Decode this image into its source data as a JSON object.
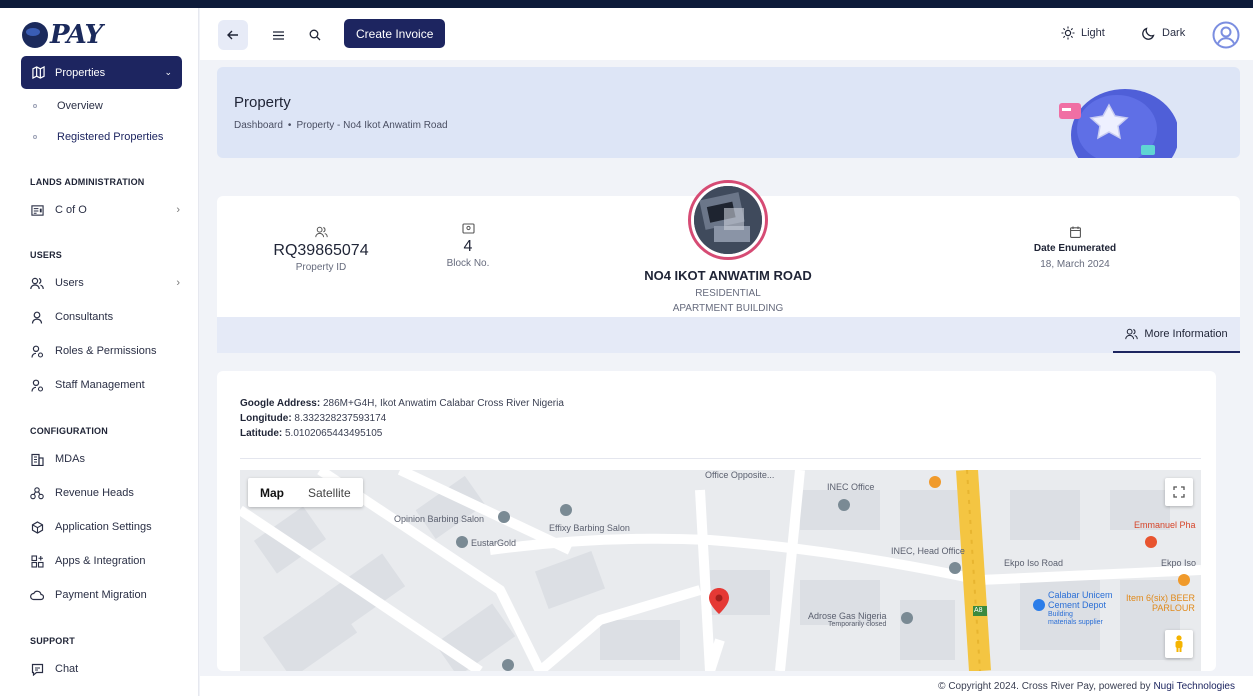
{
  "logo": {
    "text": "PAY"
  },
  "sidebar": {
    "active": {
      "label": "Properties"
    },
    "sub_items": [
      {
        "label": "Overview"
      },
      {
        "label": "Registered Properties"
      }
    ],
    "sections": [
      {
        "title": "LANDS ADMINISTRATION",
        "items": [
          {
            "label": "C of O",
            "icon": "certificate-icon"
          }
        ]
      },
      {
        "title": "USERS",
        "items": [
          {
            "label": "Users",
            "icon": "users-icon"
          },
          {
            "label": "Consultants",
            "icon": "user-icon"
          },
          {
            "label": "Roles & Permissions",
            "icon": "user-key-icon"
          },
          {
            "label": "Staff Management",
            "icon": "user-key-icon"
          }
        ]
      },
      {
        "title": "CONFIGURATION",
        "items": [
          {
            "label": "MDAs",
            "icon": "building-icon"
          },
          {
            "label": "Revenue Heads",
            "icon": "org-chart-icon"
          },
          {
            "label": "Application Settings",
            "icon": "cube-icon"
          },
          {
            "label": "Apps & Integration",
            "icon": "grid-icon"
          },
          {
            "label": "Payment Migration",
            "icon": "cloud-icon"
          }
        ]
      },
      {
        "title": "SUPPORT",
        "items": [
          {
            "label": "Chat",
            "icon": "chat-icon"
          }
        ]
      }
    ]
  },
  "header": {
    "create_label": "Create Invoice",
    "light_label": "Light",
    "dark_label": "Dark"
  },
  "page": {
    "title": "Property",
    "breadcrumb": [
      "Dashboard",
      "Property - No4 Ikot Anwatim Road"
    ]
  },
  "property": {
    "id_value": "RQ39865074",
    "id_label": "Property ID",
    "block_value": "4",
    "block_label": "Block No.",
    "name": "NO4 IKOT ANWATIM ROAD",
    "type": "RESIDENTIAL",
    "subtype": "APARTMENT BUILDING",
    "date_label": "Date Enumerated",
    "date_value": "18, March 2024",
    "more_info": "More Information"
  },
  "address": {
    "google_label": "Google Address:",
    "google_value": " 286M+G4H, Ikot Anwatim Calabar Cross River Nigeria",
    "lng_label": "Longitude:",
    "lng_value": " 8.332328237593174",
    "lat_label": "Latitude:",
    "lat_value": " 5.0102065443495105"
  },
  "map": {
    "map_tab": "Map",
    "satellite_tab": "Satellite",
    "labels": {
      "office_opposite": "Office Opposite...",
      "inec_office": "INEC Office",
      "opinion": "Opinion Barbing Salon",
      "effixy": "Effixy Barbing Salon",
      "eustar": "EustarGold",
      "inec_head": "INEC, Head Office",
      "ekpo1": "Ekpo Iso Road",
      "ekpo2": "Ekpo Iso",
      "emmanuel": "Emmanuel Pha",
      "adrose": "Adrose Gas Nigeria",
      "adrose_sub": "Temporarily closed",
      "calabar": "Calabar Unicem",
      "cement": "Cement Depot",
      "building": "Building",
      "materials": "materials supplier",
      "item6": "Item 6(six) BEER",
      "parlour": "PARLOUR",
      "route": "A8"
    }
  },
  "footer": {
    "copyright": "© Copyright 2024. Cross River Pay, powered by",
    "brand": "Nugi Technologies"
  }
}
